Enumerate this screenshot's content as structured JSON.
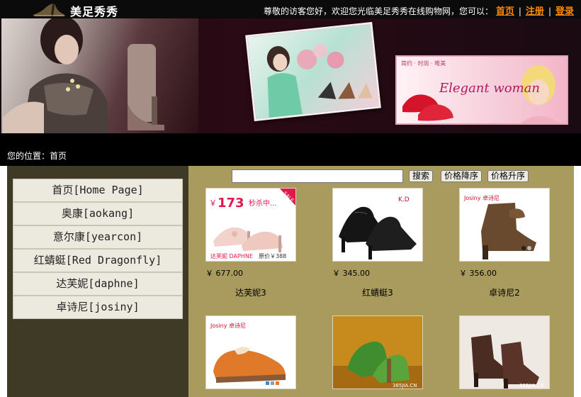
{
  "header": {
    "logo_text": "美足秀秀",
    "welcome_text": "尊敬的访客您好，欢迎您光临美足秀秀在线购物网，您可以：",
    "nav": [
      "首页",
      "注册",
      "登录"
    ],
    "nav_separator": "|"
  },
  "banner": {
    "card2_title": "Elegant woman",
    "card2_tag": "简约 · 时尚 · 唯美"
  },
  "breadcrumb": {
    "label": "您的位置：",
    "current": "首页"
  },
  "sidebar": {
    "items": [
      {
        "label": "首页[Home Page]"
      },
      {
        "label": "奥康[aokang]"
      },
      {
        "label": "意尔康[yearcon]"
      },
      {
        "label": "红蜻蜓[Red Dragonfly]"
      },
      {
        "label": "达芙妮[daphne]"
      },
      {
        "label": "卓诗尼[josiny]"
      }
    ]
  },
  "toolbar": {
    "search_value": "",
    "search_label": "搜索",
    "sort_desc_label": "价格降序",
    "sort_asc_label": "价格升序"
  },
  "products": [
    {
      "price": "￥ 677.00",
      "name": "达芙妮3",
      "promo_price": "173",
      "promo_text": "秒杀中...",
      "brand": "达芙妮 DAPHNE",
      "orig_price": "原价￥388",
      "sale_tag": "SALE"
    },
    {
      "price": "￥ 345.00",
      "name": "红蜻蜓3",
      "brand": "K.D"
    },
    {
      "price": "￥ 356.00",
      "name": "卓诗尼2",
      "brand": "Josiny 卓诗尼"
    },
    {
      "price": "",
      "name": "",
      "brand": "Josiny 卓诗尼"
    },
    {
      "price": "",
      "name": "",
      "brand": "365JIA.CN"
    },
    {
      "price": "",
      "name": "",
      "brand": "365JIA.CN"
    }
  ],
  "colors": {
    "topbar_bg": "#0b0b0b",
    "nav_link": "#ff8a00",
    "sidebar_bg": "#3e3a26",
    "content_bg": "#a99b5e",
    "menu_item_bg": "#eceadf"
  }
}
